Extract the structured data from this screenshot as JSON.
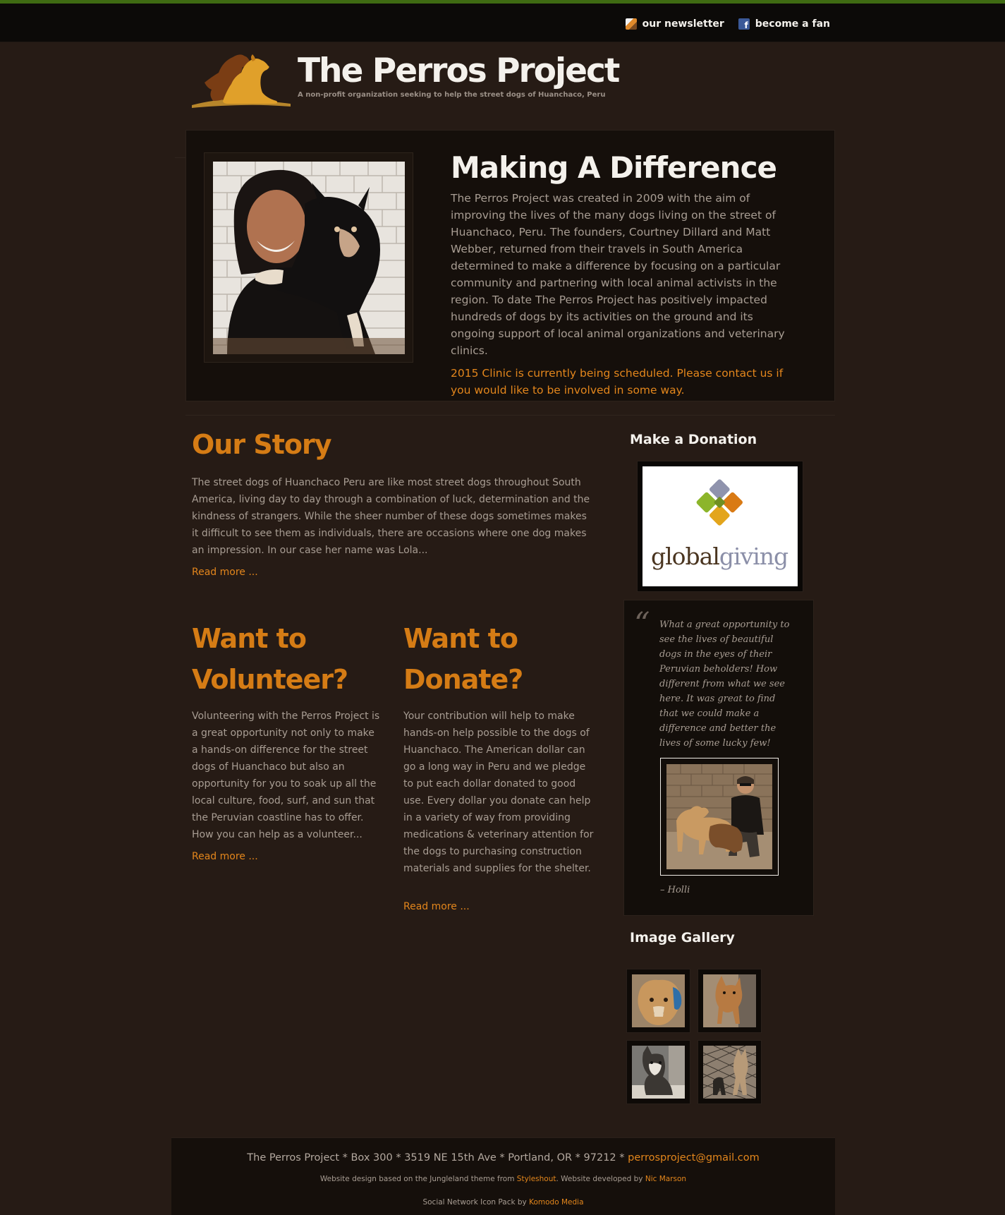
{
  "topnav": {
    "newsletter": "our newsletter",
    "fan": "become a fan"
  },
  "header": {
    "title": "The Perros Project",
    "slogan": "A non-profit organization seeking to help the street dogs of Huanchaco, Peru"
  },
  "intro": {
    "title": "Making A Difference",
    "text": "The Perros Project was created in 2009 with the aim of improving the lives of the many dogs living on the street of Huanchaco, Peru. The founders, Courtney Dillard and Matt Webber, returned from their travels in South America determined to make a difference by focusing on a particular community and partnering with local animal activists in the region. To date The Perros Project has positively impacted hundreds of dogs by its activities on the ground and its ongoing support of local animal organizations and veterinary clinics.",
    "highlight": "2015 Clinic is currently being scheduled. Please contact us if you would like to be involved in some way."
  },
  "story": {
    "title": "Our Story",
    "text": "The street dogs of Huanchaco Peru are like most street dogs throughout South America, living day to day through a combination of luck, determination and the kindness of strangers. While the sheer number of these dogs sometimes makes it difficult to see them as individuals, there are occasions where one dog makes an impression. In our case her name was Lola...",
    "read_more": "Read more ..."
  },
  "volunteer": {
    "title": "Want to Volunteer?",
    "text": "Volunteering with the Perros Project is a great opportunity not only to make a hands-on difference for the street dogs of Huanchaco but also an opportunity for you to soak up all the local culture, food, surf, and sun that the Peruvian coastline has to offer. How you can help as a volunteer...",
    "read_more": "Read more ..."
  },
  "donate": {
    "title": "Want to Donate?",
    "text": "Your contribution will help to make hands-on help possible to the dogs of Huanchaco. The American dollar can go a long way in Peru and we pledge to put each dollar donated to good use. Every dollar you donate can help in a variety of way from providing medications & veterinary attention for the dogs to purchasing construction materials and supplies for the shelter.",
    "read_more": "Read more ..."
  },
  "sidebar": {
    "donation_title": "Make a Donation",
    "globalgiving_a": "global",
    "globalgiving_b": "giving",
    "quote": "What a great opportunity to see the lives of beautiful dogs in the eyes of their Peruvian beholders! How different from what we see here. It was great to find that we could make a difference and better the lives of some lucky few!",
    "quote_author": "– Holli",
    "gallery_title": "Image Gallery"
  },
  "footer": {
    "address": "The Perros Project * Box 300 * 3519 NE 15th Ave * Portland, OR * 97212 * ",
    "email": "perrosproject@gmail.com",
    "credit_a": "Website design based on the Jungleland theme from ",
    "credit_styleshout": "Styleshout",
    "credit_b": ". Website developed by ",
    "credit_dev": "Nic Marson",
    "icons_a": "Social Network Icon Pack by ",
    "icons_komodo": "Komodo Media"
  },
  "colors": {
    "accent": "#e3861c",
    "heading_orange": "#d57c15",
    "topbar_green": "#3f6b12",
    "background": "#261b15"
  }
}
